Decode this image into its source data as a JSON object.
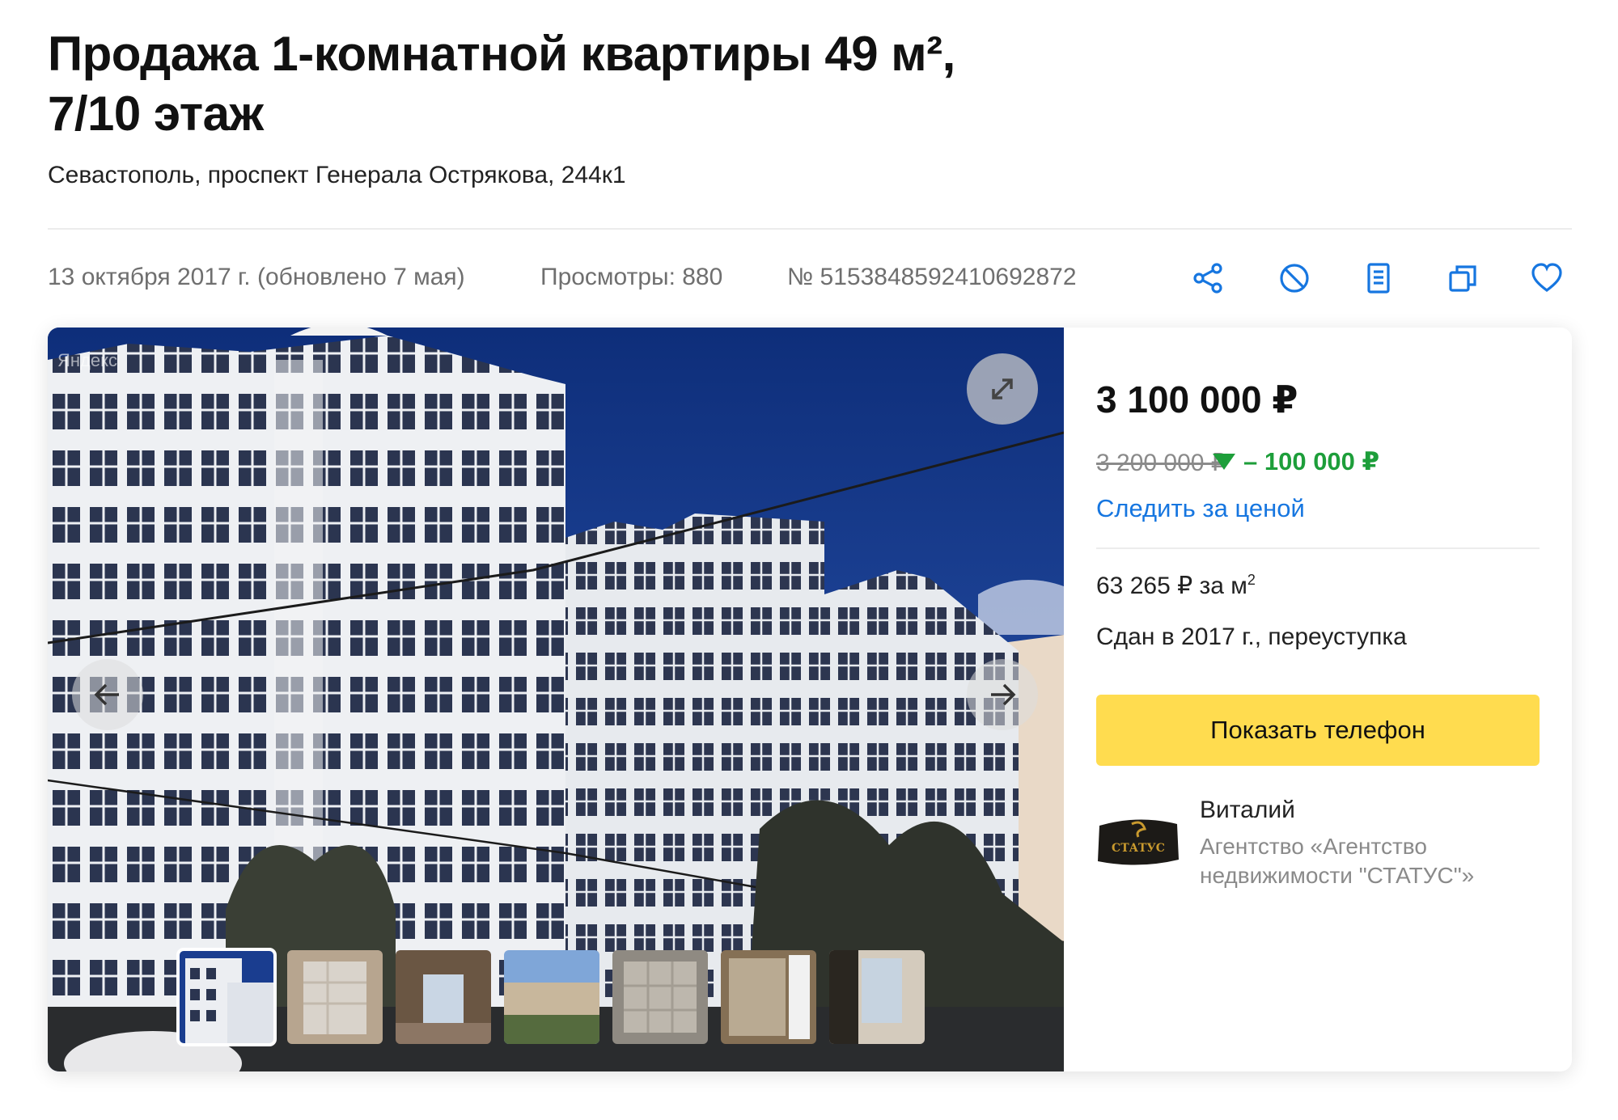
{
  "listing": {
    "title_line1": "Продажа 1-комнатной квартиры 49 м²,",
    "title_line2": "7/10 этаж",
    "address": "Севастополь, проспект Генерала Острякова, 244к1"
  },
  "meta": {
    "date": "13 октября 2017 г. (обновлено 7 мая)",
    "views": "Просмотры: 880",
    "id": "№ 5153848592410692872"
  },
  "actions": [
    {
      "icon": "share-icon"
    },
    {
      "icon": "block-icon"
    },
    {
      "icon": "report-icon"
    },
    {
      "icon": "copy-icon"
    },
    {
      "icon": "heart-icon"
    }
  ],
  "gallery": {
    "watermark": "Яндекс",
    "thumbnails_count": 7,
    "active_index": 0
  },
  "pricing": {
    "price": "3 100 000 ₽",
    "old_price": "3 200 000 ₽",
    "drop": "– 100 000 ₽",
    "follow_label": "Следить за ценой",
    "per_m2": "63 265 ₽ за м",
    "per_m2_sup": "2",
    "status": "Сдан в 2017 г., переуступка"
  },
  "contact": {
    "button_label": "Показать телефон",
    "agent_name": "Виталий",
    "agent_org": "Агентство «Агентство недвижимости \"СТАТУС\"»",
    "logo_text": "СТАТУС"
  },
  "colors": {
    "accent_blue": "#1676e0",
    "price_drop_green": "#1d9e3a",
    "button_yellow": "#ffdc4f"
  }
}
